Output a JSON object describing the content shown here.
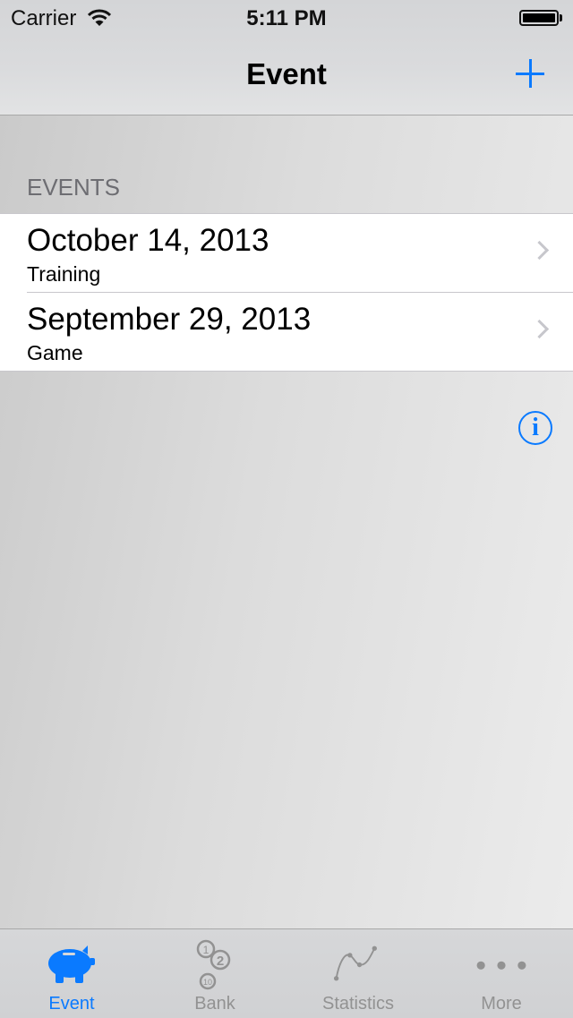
{
  "status_bar": {
    "carrier": "Carrier",
    "time": "5:11 PM",
    "battery": "full"
  },
  "nav": {
    "title": "Event",
    "add_icon": "plus-icon"
  },
  "colors": {
    "accent": "#0a7aff",
    "inactive": "#929292"
  },
  "section": {
    "header": "EVENTS"
  },
  "events": [
    {
      "date": "October 14, 2013",
      "type": "Training"
    },
    {
      "date": "September 29, 2013",
      "type": "Game"
    }
  ],
  "info": {
    "glyph": "i",
    "icon": "info-icon"
  },
  "tabs": [
    {
      "label": "Event",
      "icon": "piggy-bank-icon",
      "active": true
    },
    {
      "label": "Bank",
      "icon": "coins-icon",
      "active": false
    },
    {
      "label": "Statistics",
      "icon": "line-chart-icon",
      "active": false
    },
    {
      "label": "More",
      "icon": "more-dots-icon",
      "active": false
    }
  ]
}
